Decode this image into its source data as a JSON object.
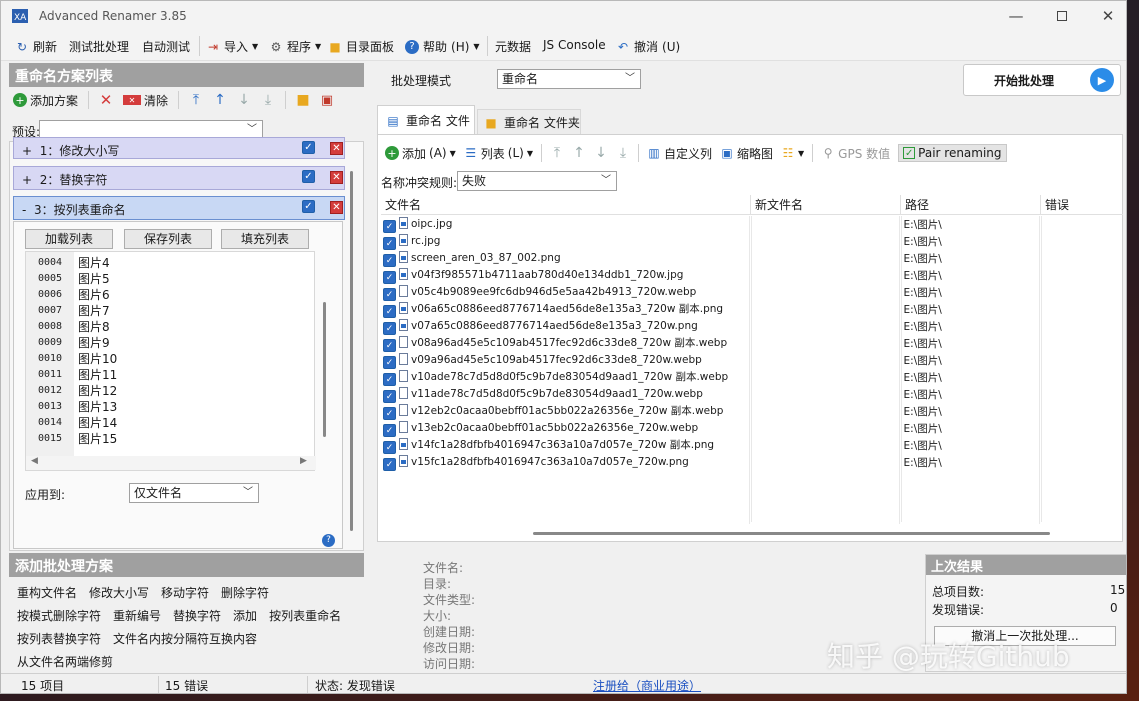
{
  "window": {
    "title": "Advanced Renamer 3.85"
  },
  "toolbar": {
    "refresh": "刷新",
    "test_batch": "测试批处理",
    "auto_test": "自动测试",
    "import": "导入",
    "program": "程序",
    "dir_panel": "目录面板",
    "help": "帮助",
    "help_key": "(H)",
    "metadata": "元数据",
    "js_console": "JS Console",
    "undo": "撤消",
    "undo_key": "(U)"
  },
  "methods_panel": {
    "title": "重命名方案列表",
    "add_method": "添加方案",
    "clear": "清除",
    "preset_label": "预设:",
    "preset_value": "",
    "methods": [
      {
        "label": "1：修改大小写",
        "toggle": "+"
      },
      {
        "label": "2：替换字符",
        "toggle": "+"
      },
      {
        "label": "3：按列表重命名",
        "toggle": "-"
      }
    ],
    "load_list": "加载列表",
    "save_list": "保存列表",
    "fill_list": "填充列表",
    "list": [
      {
        "num": "0004",
        "name": "图片4"
      },
      {
        "num": "0005",
        "name": "图片5"
      },
      {
        "num": "0006",
        "name": "图片6"
      },
      {
        "num": "0007",
        "name": "图片7"
      },
      {
        "num": "0008",
        "name": "图片8"
      },
      {
        "num": "0009",
        "name": "图片9"
      },
      {
        "num": "0010",
        "name": "图片10"
      },
      {
        "num": "0011",
        "name": "图片11"
      },
      {
        "num": "0012",
        "name": "图片12"
      },
      {
        "num": "0013",
        "name": "图片13"
      },
      {
        "num": "0014",
        "name": "图片14"
      },
      {
        "num": "0015",
        "name": "图片15"
      }
    ],
    "apply_to_label": "应用到:",
    "apply_to_value": "仅文件名"
  },
  "add_panel": {
    "title": "添加批处理方案",
    "row1": [
      "重构文件名",
      "修改大小写",
      "移动字符",
      "删除字符"
    ],
    "row2": [
      "按模式删除字符",
      "重新编号",
      "替换字符",
      "添加",
      "按列表重命名"
    ],
    "row3": [
      "按列表替换字符",
      "文件名内按分隔符互换内容"
    ],
    "row4": [
      "从文件名两端修剪"
    ]
  },
  "batch": {
    "mode_label": "批处理模式",
    "mode_value": "重命名",
    "start_button": "开始批处理"
  },
  "tabs": {
    "files": "重命名 文件",
    "folders": "重命名 文件夹"
  },
  "files_toolbar": {
    "add": "添加",
    "add_key": "(A)",
    "columns": "列表",
    "columns_key": "(L)",
    "custom_columns": "自定义列",
    "thumbnails": "缩略图",
    "gps": "GPS 数值",
    "pair": "Pair renaming"
  },
  "conflict": {
    "label": "名称冲突规则:",
    "value": "失败"
  },
  "columns": {
    "filename": "文件名",
    "newname": "新文件名",
    "path": "路径",
    "error": "错误"
  },
  "files": [
    {
      "name": "oipc.jpg",
      "path": "E:\\图片\\",
      "img": true
    },
    {
      "name": "rc.jpg",
      "path": "E:\\图片\\",
      "img": true
    },
    {
      "name": "screen_aren_03_87_002.png",
      "path": "E:\\图片\\",
      "img": true
    },
    {
      "name": "v04f3f985571b4711aab780d40e134ddb1_720w.jpg",
      "path": "E:\\图片\\",
      "img": true
    },
    {
      "name": "v05c4b9089ee9fc6db946d5e5aa42b4913_720w.webp",
      "path": "E:\\图片\\",
      "img": false
    },
    {
      "name": "v06a65c0886eed8776714aed56de8e135a3_720w 副本.png",
      "path": "E:\\图片\\",
      "img": true
    },
    {
      "name": "v07a65c0886eed8776714aed56de8e135a3_720w.png",
      "path": "E:\\图片\\",
      "img": true
    },
    {
      "name": "v08a96ad45e5c109ab4517fec92d6c33de8_720w 副本.webp",
      "path": "E:\\图片\\",
      "img": false
    },
    {
      "name": "v09a96ad45e5c109ab4517fec92d6c33de8_720w.webp",
      "path": "E:\\图片\\",
      "img": false
    },
    {
      "name": "v10ade78c7d5d8d0f5c9b7de83054d9aad1_720w 副本.webp",
      "path": "E:\\图片\\",
      "img": false
    },
    {
      "name": "v11ade78c7d5d8d0f5c9b7de83054d9aad1_720w.webp",
      "path": "E:\\图片\\",
      "img": false
    },
    {
      "name": "v12eb2c0acaa0bebff01ac5bb022a26356e_720w 副本.webp",
      "path": "E:\\图片\\",
      "img": false
    },
    {
      "name": "v13eb2c0acaa0bebff01ac5bb022a26356e_720w.webp",
      "path": "E:\\图片\\",
      "img": false
    },
    {
      "name": "v14fc1a28dfbfb4016947c363a10a7d057e_720w 副本.png",
      "path": "E:\\图片\\",
      "img": true
    },
    {
      "name": "v15fc1a28dfbfb4016947c363a10a7d057e_720w.png",
      "path": "E:\\图片\\",
      "img": true
    }
  ],
  "file_info": [
    "文件名:",
    "目录:",
    "文件类型:",
    "大小:",
    "创建日期:",
    "修改日期:",
    "访问日期:"
  ],
  "last_result": {
    "title": "上次结果",
    "total_label": "总项目数:",
    "total_value": "15",
    "errors_label": "发现错误:",
    "errors_value": "0",
    "undo_button": "撤消上一次批处理..."
  },
  "status": {
    "items": "15 项目",
    "errors": "15 错误",
    "state": "状态: 发现错误",
    "register": "注册给（商业用途）"
  },
  "watermark": "知乎 @玩转Github"
}
